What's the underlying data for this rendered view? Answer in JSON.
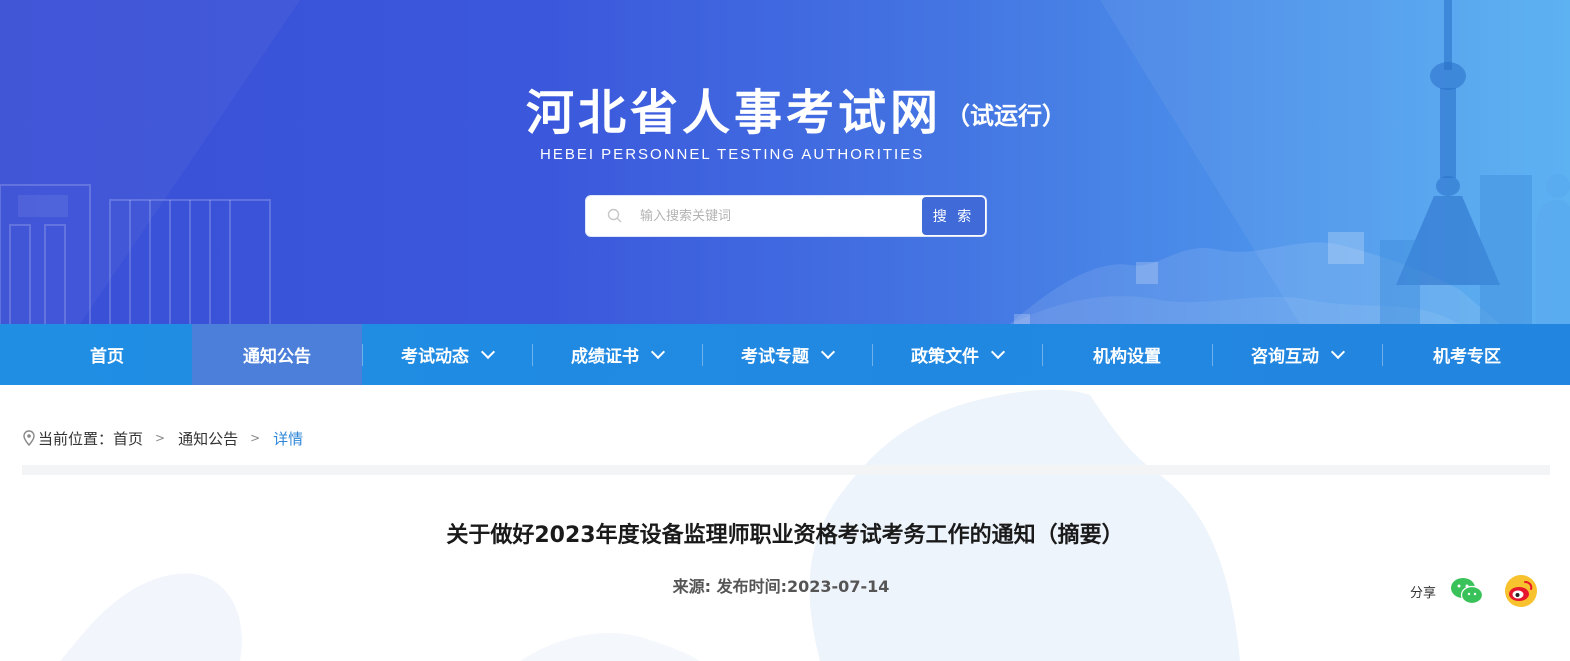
{
  "header": {
    "site_title": "河北省人事考试网",
    "trial_tag": "（试运行）",
    "subtitle_en": "HEBEI  PERSONNEL  TESTING AUTHORITIES",
    "search": {
      "placeholder": "输入搜索关键词",
      "button_label": "搜 索",
      "icon": "search-icon"
    }
  },
  "nav": {
    "items": [
      {
        "label": "首页",
        "has_dropdown": false,
        "active": false
      },
      {
        "label": "通知公告",
        "has_dropdown": false,
        "active": true
      },
      {
        "label": "考试动态",
        "has_dropdown": true,
        "active": false
      },
      {
        "label": "成绩证书",
        "has_dropdown": true,
        "active": false
      },
      {
        "label": "考试专题",
        "has_dropdown": true,
        "active": false
      },
      {
        "label": "政策文件",
        "has_dropdown": true,
        "active": false
      },
      {
        "label": "机构设置",
        "has_dropdown": false,
        "active": false
      },
      {
        "label": "咨询互动",
        "has_dropdown": true,
        "active": false
      },
      {
        "label": "机考专区",
        "has_dropdown": false,
        "active": false
      }
    ],
    "active_color": "#4b7fd9",
    "bar_color": "#2189e2"
  },
  "breadcrumb": {
    "prefix": "当前位置：",
    "items": [
      "首页",
      "通知公告",
      "详情"
    ],
    "separator": ">",
    "current_color": "#2f86d9"
  },
  "article": {
    "title": "关于做好2023年度设备监理师职业资格考试考务工作的通知（摘要）",
    "meta": "来源:  发布时间:2023-07-14"
  },
  "share": {
    "label": "分享",
    "icons": [
      "wechat-icon",
      "weibo-icon"
    ]
  }
}
